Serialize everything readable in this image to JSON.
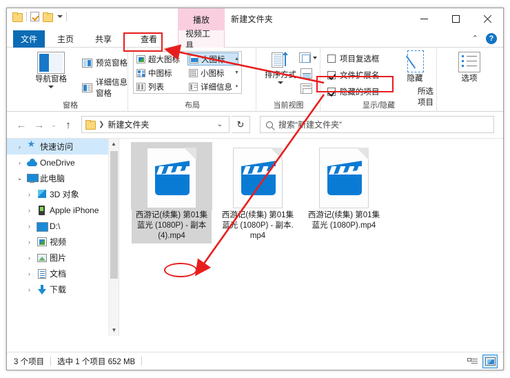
{
  "window": {
    "title": "新建文件夹",
    "quick_access": [
      "folder-icon",
      "properties-icon",
      "new-folder-icon",
      "dropdown-caret"
    ],
    "buttons": {
      "minimize": "—",
      "maximize": "□",
      "close": "✕"
    },
    "collapse_ribbon": "⌃",
    "help": "?"
  },
  "contextual_tab": {
    "header": "播放",
    "tab": "视频工具"
  },
  "tabs": [
    {
      "id": "file",
      "label": "文件"
    },
    {
      "id": "home",
      "label": "主页"
    },
    {
      "id": "share",
      "label": "共享"
    },
    {
      "id": "view",
      "label": "查看"
    }
  ],
  "ribbon": {
    "groups": [
      {
        "id": "panes",
        "label": "窗格"
      },
      {
        "id": "layout",
        "label": "布局"
      },
      {
        "id": "current_view",
        "label": "当前视图"
      },
      {
        "id": "show_hide",
        "label": "显示/隐藏"
      },
      {
        "id": "options",
        "label": ""
      }
    ],
    "panes": {
      "nav_pane": "导航窗格",
      "preview_pane": "预览窗格",
      "details_pane": "详细信息窗格"
    },
    "layout_gallery": [
      {
        "label": "超大图标",
        "selected": false
      },
      {
        "label": "大图标",
        "selected": true
      },
      {
        "label": "中图标",
        "selected": false
      },
      {
        "label": "小图标",
        "selected": false
      },
      {
        "label": "列表",
        "selected": false
      },
      {
        "label": "详细信息",
        "selected": false
      }
    ],
    "current_view": {
      "sort_by": "排序方式"
    },
    "show_hide": {
      "item_checkboxes": {
        "label": "项目复选框",
        "checked": false
      },
      "file_extensions": {
        "label": "文件扩展名",
        "checked": true
      },
      "hidden_items": {
        "label": "隐藏的项目",
        "checked": true
      },
      "hide_button": "隐藏",
      "selected_items": "所选项目"
    },
    "options": {
      "label": "选项"
    }
  },
  "addressbar": {
    "back": "←",
    "forward": "→",
    "recent": "⌄",
    "up": "↑",
    "crumb": "新建文件夹",
    "crumb_caret": "⌄",
    "refresh": "↻",
    "search_placeholder": "搜索“新建文件夹”"
  },
  "navigation_tree": [
    {
      "label": "快速访问",
      "icon": "star-icon",
      "indent": 0,
      "expander": "›",
      "selected": true
    },
    {
      "label": "OneDrive",
      "icon": "cloud-icon",
      "indent": 0,
      "expander": "›",
      "selected": false
    },
    {
      "label": "此电脑",
      "icon": "pc-icon",
      "indent": 0,
      "expander": "⌄",
      "selected": false
    },
    {
      "label": "3D 对象",
      "icon": "3d-icon",
      "indent": 1,
      "expander": "›",
      "selected": false
    },
    {
      "label": "Apple iPhone",
      "icon": "phone-icon",
      "indent": 1,
      "expander": "›",
      "selected": false
    },
    {
      "label": "D:\\",
      "icon": "drive-icon",
      "indent": 1,
      "expander": "›",
      "selected": false
    },
    {
      "label": "视频",
      "icon": "video-icon",
      "indent": 1,
      "expander": "›",
      "selected": false
    },
    {
      "label": "图片",
      "icon": "picture-icon",
      "indent": 1,
      "expander": "›",
      "selected": false
    },
    {
      "label": "文档",
      "icon": "document-icon",
      "indent": 1,
      "expander": "›",
      "selected": false
    },
    {
      "label": "下载",
      "icon": "download-icon",
      "indent": 1,
      "expander": "›",
      "selected": false
    }
  ],
  "files": [
    {
      "name": "西游记(续集) 第01集 蓝光 (1080P) - 副本 (4).mp4",
      "type": "mp4",
      "selected": true
    },
    {
      "name": "西游记(续集) 第01集 蓝光 (1080P) - 副本.mp4",
      "type": "mp4",
      "selected": false
    },
    {
      "name": "西游记(续集) 第01集 蓝光 (1080P).mp4",
      "type": "mp4",
      "selected": false
    }
  ],
  "statusbar": {
    "item_count": "3 个项目",
    "selection": "选中 1 个项目  652 MB",
    "views": [
      {
        "id": "details-view",
        "active": false
      },
      {
        "id": "large-icons-view",
        "active": true
      }
    ]
  },
  "annotations": {
    "color": "#e81e1e",
    "highlight_view_tab": "查看",
    "highlight_file_extensions": "文件扩展名",
    "circled_extension": "mp4"
  }
}
